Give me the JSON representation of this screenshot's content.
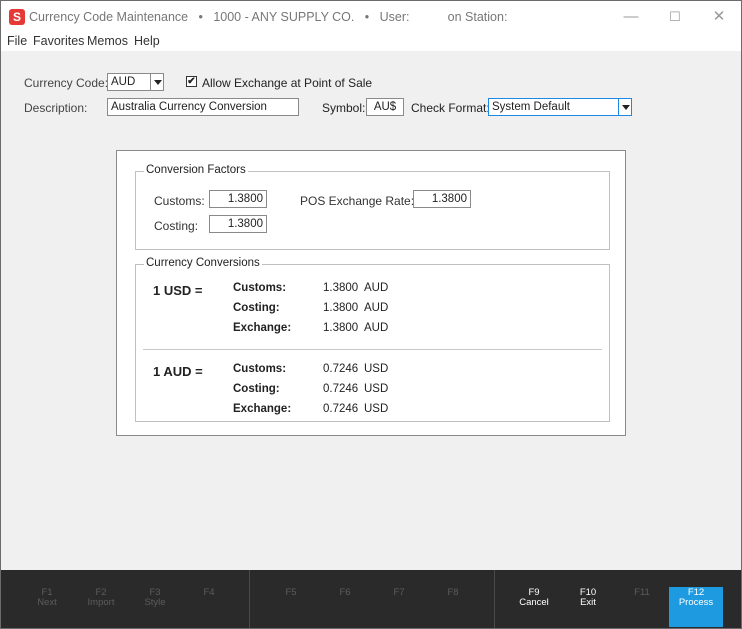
{
  "window": {
    "app_icon": "S",
    "title": "Currency Code Maintenance   •   1000 - ANY SUPPLY CO.   •   User:           on Station:",
    "minimize_icon": "minimize-icon",
    "maximize_icon": "maximize-icon",
    "close_icon": "close-icon"
  },
  "menu": [
    "File",
    "Favorites",
    "Memos",
    "Help"
  ],
  "form": {
    "currency_code_label": "Currency Code:",
    "currency_code_value": "AUD",
    "allow_exchange_checked": "✔",
    "allow_exchange_label": "Allow Exchange at Point of Sale",
    "description_label": "Description:",
    "description_value": "Australia Currency Conversion",
    "symbol_label": "Symbol:",
    "symbol_value": "AU$",
    "check_format_label": "Check Format:",
    "check_format_value": "System Default"
  },
  "conversion_factors": {
    "title": "Conversion Factors",
    "customs_label": "Customs:",
    "customs_value": "1.3800",
    "costing_label": "Costing:",
    "costing_value": "1.3800",
    "pos_rate_label": "POS Exchange Rate:",
    "pos_rate_value": "1.3800"
  },
  "currency_conversions": {
    "title": "Currency Conversions",
    "blocks": [
      {
        "header": "1 USD =",
        "rows": [
          {
            "label": "Customs:",
            "value": "1.3800",
            "unit": "AUD"
          },
          {
            "label": "Costing:",
            "value": "1.3800",
            "unit": "AUD"
          },
          {
            "label": "Exchange:",
            "value": "1.3800",
            "unit": "AUD"
          }
        ]
      },
      {
        "header": "1 AUD =",
        "rows": [
          {
            "label": "Customs:",
            "value": "0.7246",
            "unit": "USD"
          },
          {
            "label": "Costing:",
            "value": "0.7246",
            "unit": "USD"
          },
          {
            "label": "Exchange:",
            "value": "0.7246",
            "unit": "USD"
          }
        ]
      }
    ]
  },
  "function_keys": [
    {
      "key": "F1",
      "label": "Next"
    },
    {
      "key": "F2",
      "label": "Import"
    },
    {
      "key": "F3",
      "label": "Style"
    },
    {
      "key": "F4",
      "label": ""
    },
    {
      "key": "F5",
      "label": ""
    },
    {
      "key": "F6",
      "label": ""
    },
    {
      "key": "F7",
      "label": ""
    },
    {
      "key": "F8",
      "label": ""
    },
    {
      "key": "F9",
      "label": "Cancel"
    },
    {
      "key": "F10",
      "label": "Exit"
    },
    {
      "key": "F11",
      "label": ""
    },
    {
      "key": "F12",
      "label": "Process"
    }
  ],
  "colors": {
    "accent": "#1e9be0",
    "app_icon": "#e53935",
    "function_bar": "#2a2a2a"
  }
}
